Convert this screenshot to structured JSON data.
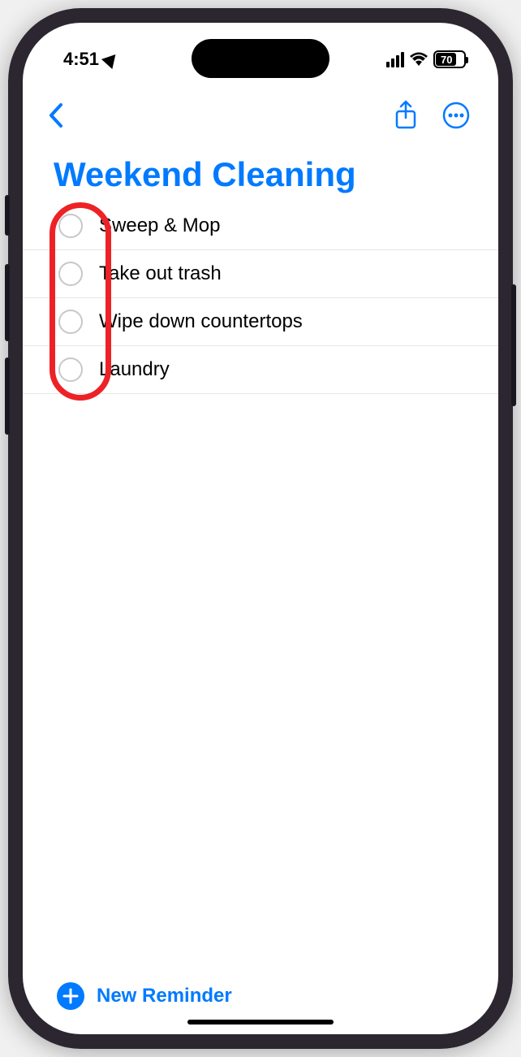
{
  "status": {
    "time": "4:51",
    "battery_text": "70"
  },
  "list": {
    "title": "Weekend Cleaning",
    "items": [
      {
        "label": "Sweep & Mop"
      },
      {
        "label": "Take out trash"
      },
      {
        "label": "Wipe down countertops"
      },
      {
        "label": "Laundry"
      }
    ]
  },
  "footer": {
    "new_label": "New Reminder"
  }
}
